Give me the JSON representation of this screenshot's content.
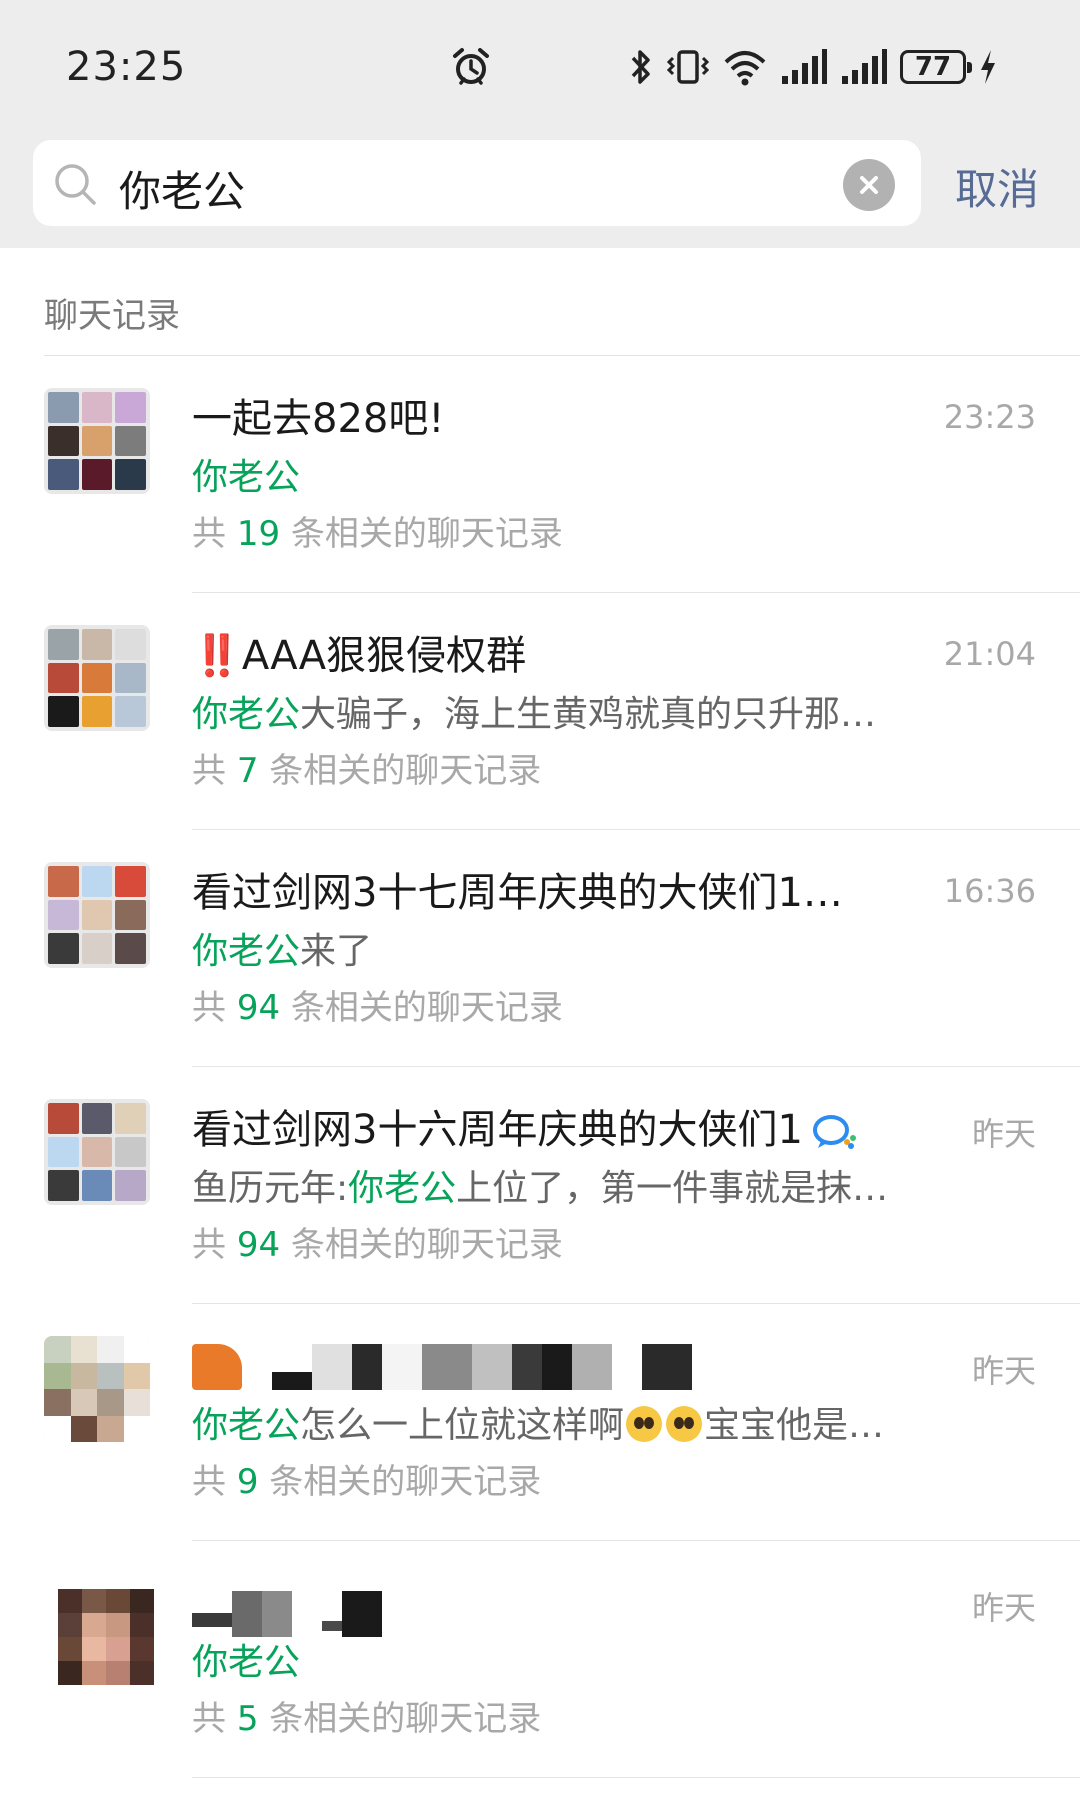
{
  "status_bar": {
    "time": "23:25",
    "battery": "77",
    "icons": [
      "alarm-icon",
      "bluetooth-icon",
      "vibrate-icon",
      "wifi-icon",
      "signal-icon",
      "signal-icon",
      "battery-icon",
      "charging-icon"
    ]
  },
  "search": {
    "query": "你老公",
    "cancel_label": "取消"
  },
  "section": {
    "title": "聊天记录"
  },
  "results": [
    {
      "title": "一起去828吧!",
      "time": "23:23",
      "snippet_prefix": "",
      "snippet_highlight": "你老公",
      "snippet_suffix": "",
      "count_prefix": "共",
      "count": "19",
      "count_suffix": "条相关的聊天记录"
    },
    {
      "title_marks": "‼️",
      "title": "AAA狠狠侵权群",
      "time": "21:04",
      "snippet_prefix": "",
      "snippet_highlight": "你老公",
      "snippet_suffix": "大骗子，海上生黄鸡就真的只升那…",
      "count_prefix": "共",
      "count": "7",
      "count_suffix": "条相关的聊天记录"
    },
    {
      "title": "看过剑网3十七周年庆典的大侠们1…",
      "time": "16:36",
      "snippet_prefix": "",
      "snippet_highlight": "你老公",
      "snippet_suffix": "来了",
      "count_prefix": "共",
      "count": "94",
      "count_suffix": "条相关的聊天记录"
    },
    {
      "title": "看过剑网3十六周年庆典的大侠们1",
      "time": "昨天",
      "snippet_prefix": "鱼历元年:",
      "snippet_highlight": "你老公",
      "snippet_suffix": "上位了，第一件事就是抹…",
      "count_prefix": "共",
      "count": "94",
      "count_suffix": "条相关的聊天记录"
    },
    {
      "title": "",
      "time": "昨天",
      "snippet_prefix": "",
      "snippet_highlight": "你老公",
      "snippet_suffix_a": "怎么一上位就这样啊",
      "snippet_suffix_b": "宝宝他是…",
      "count_prefix": "共",
      "count": "9",
      "count_suffix": "条相关的聊天记录"
    },
    {
      "title": "",
      "time": "昨天",
      "snippet_prefix": "",
      "snippet_highlight": "你老公",
      "snippet_suffix": "",
      "count_prefix": "共",
      "count": "5",
      "count_suffix": "条相关的聊天记录"
    }
  ],
  "colors": {
    "highlight": "#07a35a",
    "cancel": "#576b95",
    "header_bg": "#ededed",
    "alert": "#e5312c"
  }
}
